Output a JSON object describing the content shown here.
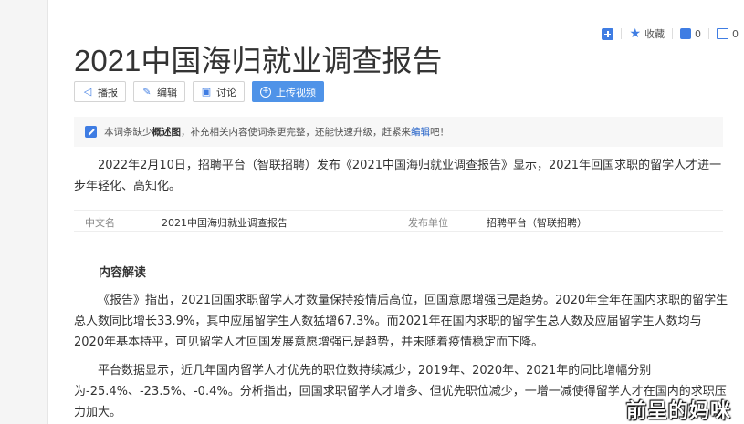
{
  "toolbar": {
    "collect_label": "收藏",
    "like_count": "0",
    "share_count": "0"
  },
  "title": "2021中国海归就业调查报告",
  "buttons": {
    "broadcast": "播报",
    "edit": "编辑",
    "discuss": "讨论",
    "upload_video": "上传视频"
  },
  "notice": {
    "prefix": "本词条缺少",
    "bold": "概述图",
    "middle": "，补充相关内容使词条更完整，还能快速升级，赶紧来",
    "link": "编辑",
    "suffix": "吧！"
  },
  "intro": "2022年2月10日，招聘平台（智联招聘）发布《2021中国海归就业调查报告》显示，2021年回国求职的留学人才进一步年轻化、高知化。",
  "infobox": {
    "k1": "中文名",
    "v1": "2021中国海归就业调查报告",
    "k2": "发布单位",
    "v2": "招聘平台（智联招聘）"
  },
  "section_title": "内容解读",
  "para2": "《报告》指出，2021回国求职留学人才数量保持疫情后高位，回国意愿增强已是趋势。2020年全年在国内求职的留学生总人数同比增长33.9%，其中应届留学生人数猛增67.3%。而2021年在国内求职的留学生总人数及应届留学生人数均与2020年基本持平，可见留学人才回国发展意愿增强已是趋势，并未随着疫情稳定而下降。",
  "para3": "平台数据显示，近几年国内留学人才优先的职位数持续减少，2019年、2020年、2021年的同比增幅分别为-25.4%、-23.5%、-0.4%。分析指出，回国求职留学人才增多、但优先职位减少，一增一减使得留学人才在国内的求职压力加大。",
  "watermark": "前呈的妈咪",
  "icons": {
    "add": "plus-square-icon",
    "collect": "star-icon",
    "like": "thumbs-up-icon",
    "share": "share-icon",
    "broadcast": "speaker-icon",
    "edit": "pencil-icon",
    "discuss": "chat-icon",
    "upload": "plus-circle-icon",
    "notice": "pencil-square-icon"
  },
  "colors": {
    "accent": "#3f7de3",
    "primary_button": "#4f93e8"
  }
}
